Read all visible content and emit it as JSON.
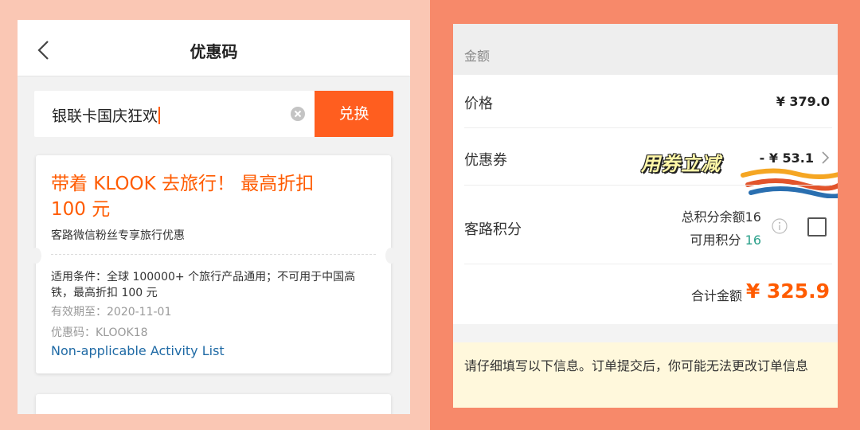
{
  "left_screen": {
    "title": "优惠码",
    "search": {
      "value": "银联卡国庆狂欢"
    },
    "redeem_label": "兑换",
    "coupon": {
      "title": "带着 KLOOK 去旅行！ 最高折扣 100 元",
      "subtitle": "客路微信粉丝专享旅行优惠",
      "conditions": "适用条件：全球 100000+ 个旅行产品通用；不可用于中国高铁，最高折扣 100 元",
      "expiry": "有效期至：2020-11-01",
      "code": "优惠码：KLOOK18",
      "link_text": "Non-applicable Activity List"
    }
  },
  "right_screen": {
    "section_label": "金额",
    "price_label": "价格",
    "price_value": "¥ 379.0",
    "coupon_label": "优惠券",
    "coupon_value": "- ¥ 53.1",
    "promo_overlay": "用券立减",
    "points_label": "客路积分",
    "points_total": "总积分余额16",
    "points_available_label": "可用积分",
    "points_available_value": "16",
    "total_label": "合计金额",
    "total_value": "¥ 325.9",
    "notice": "请仔细填写以下信息。订单提交后，你可能无法更改订单信息"
  },
  "colors": {
    "accent": "#ff5e1f",
    "left_background": "#fac7b4",
    "right_background": "#f7896a",
    "link": "#1f6aa5",
    "points_green": "#2aa08a",
    "notice_bg": "#fff8dc"
  },
  "icons": [
    "back-icon",
    "clear-icon",
    "chevron-right-icon",
    "info-icon",
    "checkbox"
  ]
}
